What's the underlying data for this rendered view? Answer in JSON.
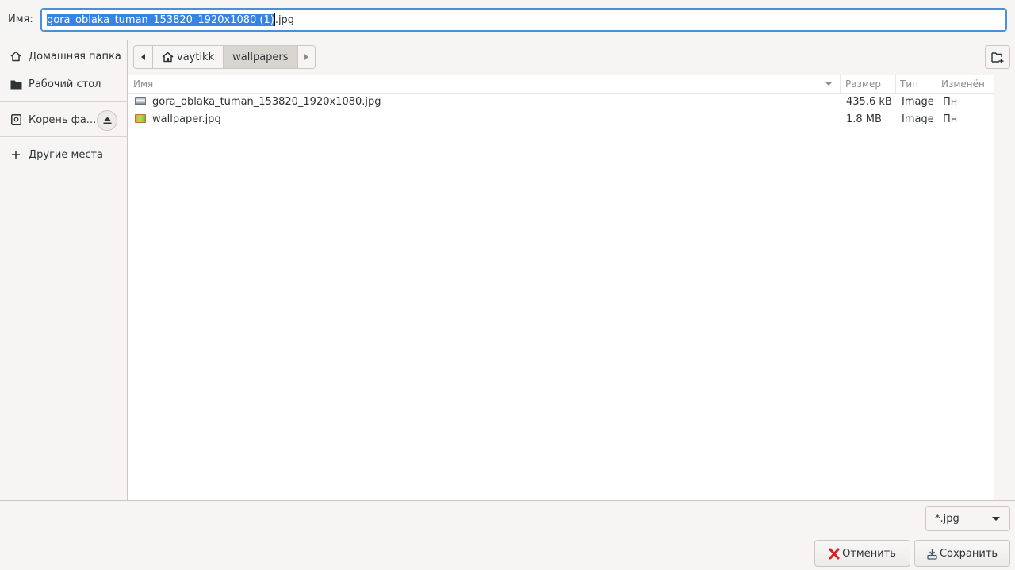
{
  "name_bar": {
    "label": "Имя:",
    "value_selected": "gora_oblaka_tuman_153820_1920x1080 (1)",
    "value_rest": ".jpg"
  },
  "sidebar": {
    "items": [
      {
        "label": "Домашняя папка",
        "icon": "home-icon"
      },
      {
        "label": "Рабочий стол",
        "icon": "folder-icon"
      },
      {
        "label": "Корень фа...",
        "icon": "drive-icon"
      },
      {
        "label": "Другие места",
        "icon": "plus-icon"
      }
    ]
  },
  "pathbar": {
    "items": [
      "vaytikk",
      "wallpapers"
    ]
  },
  "columns": {
    "name": "Имя",
    "size": "Размер",
    "type": "Тип",
    "modified": "Изменён"
  },
  "files": [
    {
      "name": "gora_oblaka_tuman_153820_1920x1080.jpg",
      "size": "435.6 kB",
      "type": "Image",
      "modified": "Пн"
    },
    {
      "name": "wallpaper.jpg",
      "size": "1.8 MB",
      "type": "Image",
      "modified": "Пн"
    }
  ],
  "filter": {
    "selected": "*.jpg"
  },
  "buttons": {
    "cancel": "Отменить",
    "save": "Сохранить"
  },
  "colors": {
    "accent": "#3584e4",
    "focus_border": "#4a90d9"
  }
}
